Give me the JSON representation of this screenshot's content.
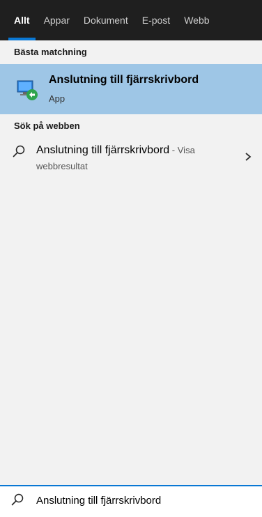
{
  "tabs": [
    {
      "label": "Allt",
      "active": true
    },
    {
      "label": "Appar"
    },
    {
      "label": "Dokument"
    },
    {
      "label": "E-post"
    },
    {
      "label": "Webb"
    }
  ],
  "best_match": {
    "header": "Bästa matchning",
    "title": "Anslutning till fjärrskrivbord",
    "subtitle": "App",
    "icon": "remote-desktop-icon"
  },
  "web": {
    "header": "Sök på webben",
    "title": "Anslutning till fjärrskrivbord",
    "visa": " - Visa",
    "subtitle": "webbresultat",
    "icon": "search-icon"
  },
  "search": {
    "value": "Anslutning till fjärrskrivbord"
  },
  "colors": {
    "accent": "#0a78d4",
    "tab_bg": "#1f1f1f",
    "highlight": "#9ec6e6",
    "panel_bg": "#f2f2f2"
  }
}
